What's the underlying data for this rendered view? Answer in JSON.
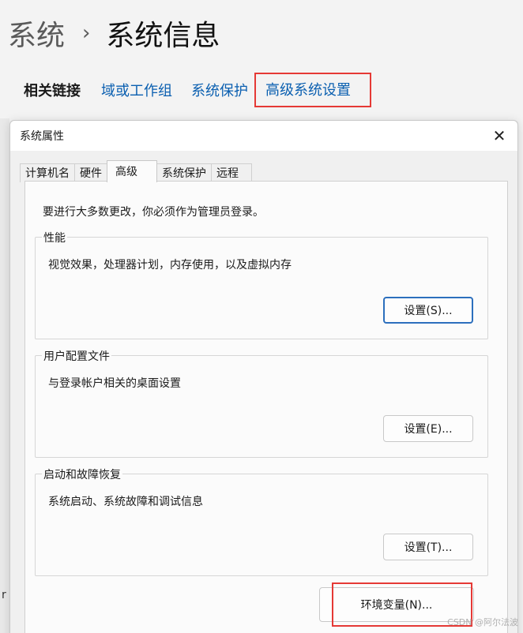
{
  "breadcrumb": {
    "parent": "系统",
    "separator": "›",
    "current": "系统信息"
  },
  "related_links": {
    "title": "相关链接",
    "items": [
      "域或工作组",
      "系统保护",
      "高级系统设置"
    ]
  },
  "left_fragment": "r",
  "dialog": {
    "title": "系统属性",
    "close_glyph": "✕",
    "tabs": [
      "计算机名",
      "硬件",
      "高级",
      "系统保护",
      "远程"
    ],
    "active_tab": "高级",
    "notice": "要进行大多数更改，你必须作为管理员登录。",
    "groups": [
      {
        "legend": "性能",
        "description": "视觉效果，处理器计划，内存使用，以及虚拟内存",
        "button": "设置(S)..."
      },
      {
        "legend": "用户配置文件",
        "description": "与登录帐户相关的桌面设置",
        "button": "设置(E)..."
      },
      {
        "legend": "启动和故障恢复",
        "description": "系统启动、系统故障和调试信息",
        "button": "设置(T)..."
      }
    ],
    "env_button": "环境变量(N)..."
  },
  "watermark": "CSDN @阿尔法波",
  "colors": {
    "highlight": "#e53935",
    "link": "#0a5fb0",
    "focus": "#2c6fbd"
  }
}
